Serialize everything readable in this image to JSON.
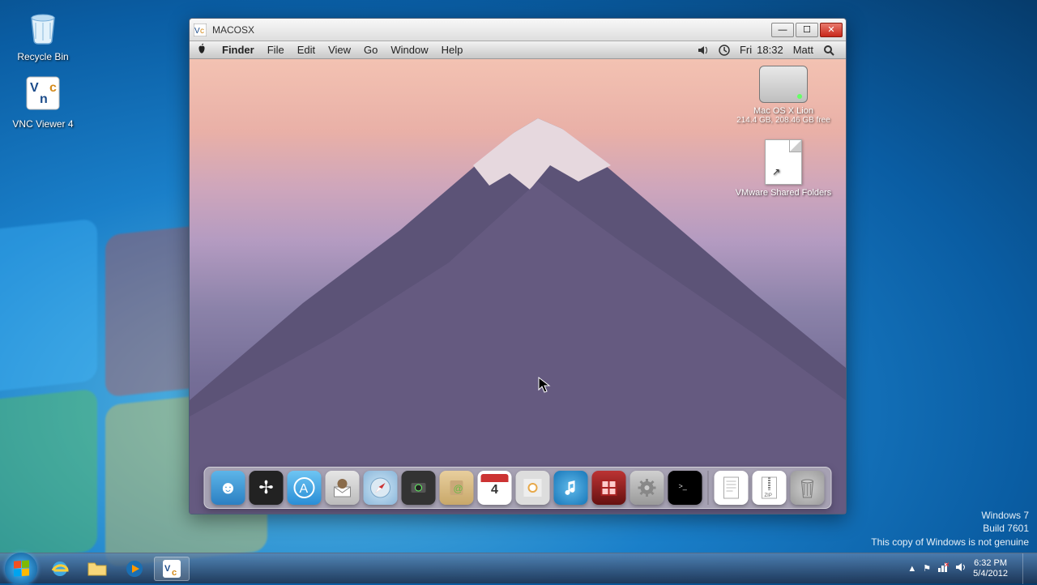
{
  "desktop": {
    "icons": [
      {
        "label": "Recycle Bin"
      },
      {
        "label": "VNC Viewer 4"
      }
    ]
  },
  "vnc_window": {
    "title": "MACOSX"
  },
  "mac": {
    "menu": [
      "Finder",
      "File",
      "Edit",
      "View",
      "Go",
      "Window",
      "Help"
    ],
    "status": {
      "day": "Fri",
      "time": "18:32",
      "user": "Matt"
    },
    "desktop_icons": {
      "disk": {
        "name": "Mac OS X Lion",
        "sub": "214.4 GB, 208.46 GB free"
      },
      "folder": {
        "name": "VMware Shared Folders"
      }
    },
    "calendar_day": "4",
    "dock": [
      "Finder",
      "Dashboard",
      "App Store",
      "Mail",
      "Safari",
      "FaceTime",
      "Address Book",
      "iCal",
      "iPhoto",
      "iTunes",
      "Photo Booth",
      "System Preferences",
      "Terminal",
      "Document",
      "Archive",
      "Trash"
    ]
  },
  "watermark": {
    "line1": "Windows 7",
    "line2": "Build 7601",
    "line3": "This copy of Windows is not genuine"
  },
  "taskbar": {
    "time": "6:32 PM",
    "date": "5/4/2012"
  }
}
